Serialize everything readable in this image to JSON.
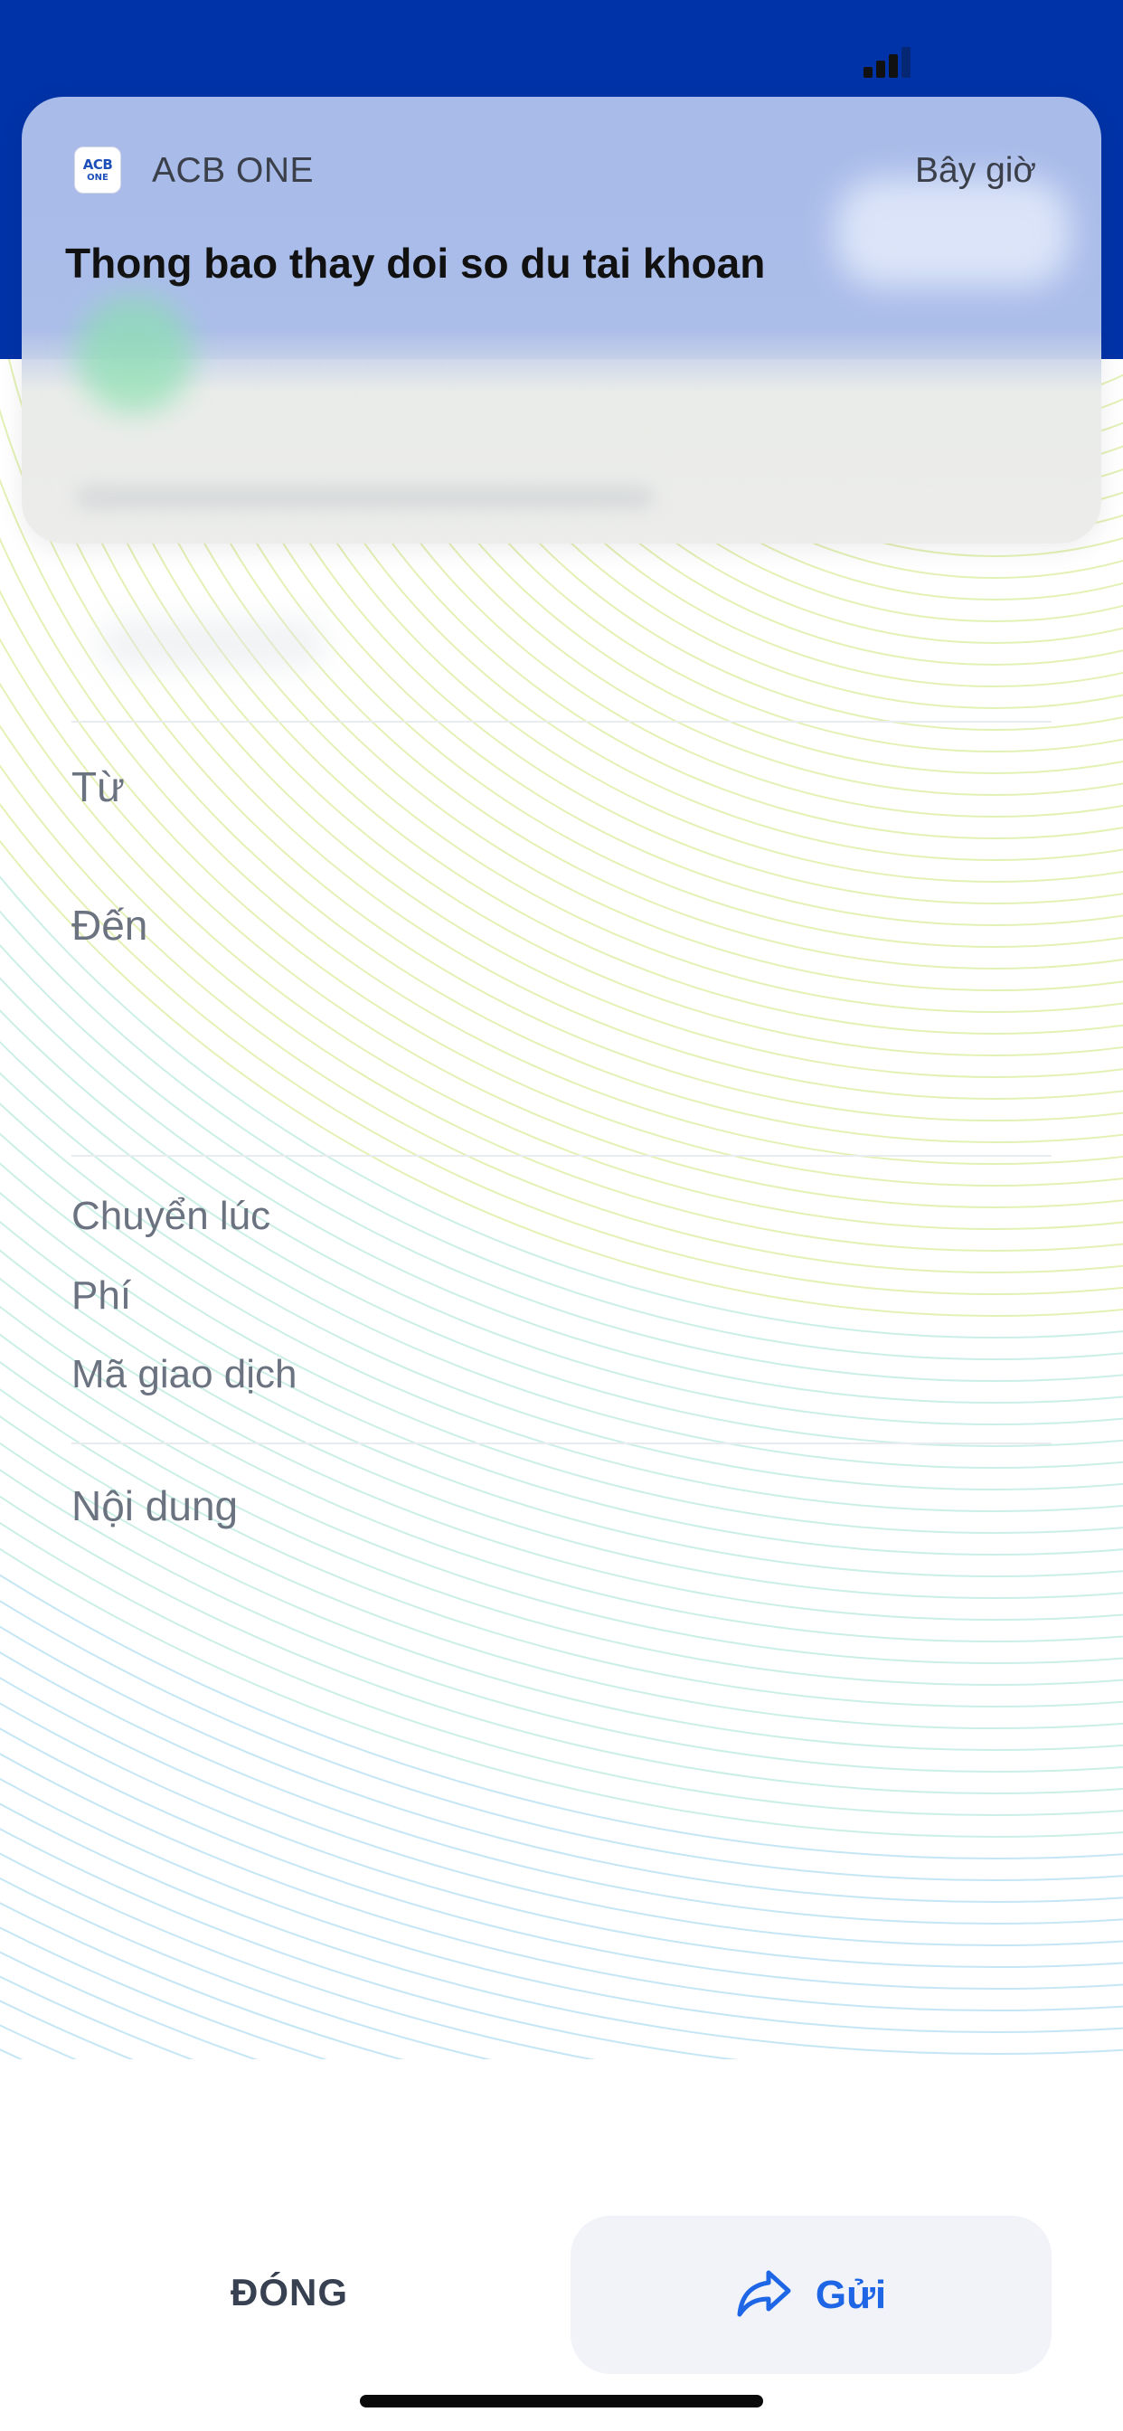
{
  "notification": {
    "app_name": "ACB ONE",
    "app_icon_line1": "ACB",
    "app_icon_line2": "ONE",
    "time": "Bây giờ",
    "title": "Thong bao thay doi so du tai khoan"
  },
  "receipt": {
    "from_label": "Từ",
    "to_label": "Đến",
    "transfer_time_label": "Chuyển lúc",
    "fee_label": "Phí",
    "transaction_code_label": "Mã giao dịch",
    "content_label": "Nội dung"
  },
  "actions": {
    "close_label": "ĐÓNG",
    "send_label": "Gửi"
  },
  "icons": {
    "signal": "cellular-signal-icon",
    "share": "share-arrow-icon"
  },
  "colors": {
    "header_blue": "#0033a8",
    "send_blue": "#1e66e6"
  }
}
